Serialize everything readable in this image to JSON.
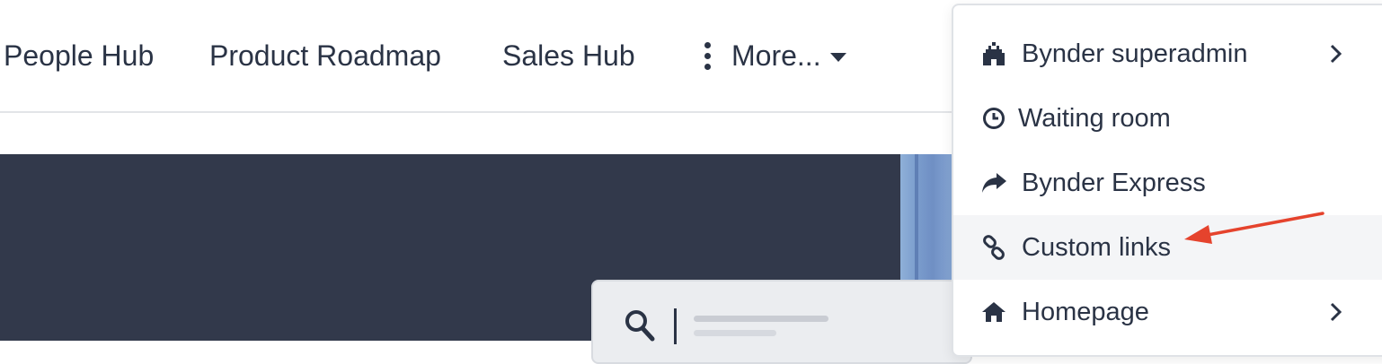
{
  "nav": {
    "items": [
      {
        "label": "People Hub"
      },
      {
        "label": "Product Roadmap"
      },
      {
        "label": "Sales Hub"
      }
    ],
    "more_label": "More..."
  },
  "menu": {
    "items": [
      {
        "label": "Bynder superadmin",
        "icon": "castle-icon",
        "has_submenu": true
      },
      {
        "label": "Waiting room",
        "icon": "clock-icon",
        "has_submenu": false
      },
      {
        "label": "Bynder Express",
        "icon": "share-arrow-icon",
        "has_submenu": false
      },
      {
        "label": "Custom links",
        "icon": "link-icon",
        "has_submenu": false,
        "highlighted": true
      },
      {
        "label": "Homepage",
        "icon": "home-icon",
        "has_submenu": true
      }
    ]
  },
  "annotation": {
    "color": "#e5432d",
    "points_to": "Custom links"
  },
  "colors": {
    "hero_bg": "#32394b",
    "text": "#2a3345",
    "highlight_bg": "#f4f5f7"
  }
}
